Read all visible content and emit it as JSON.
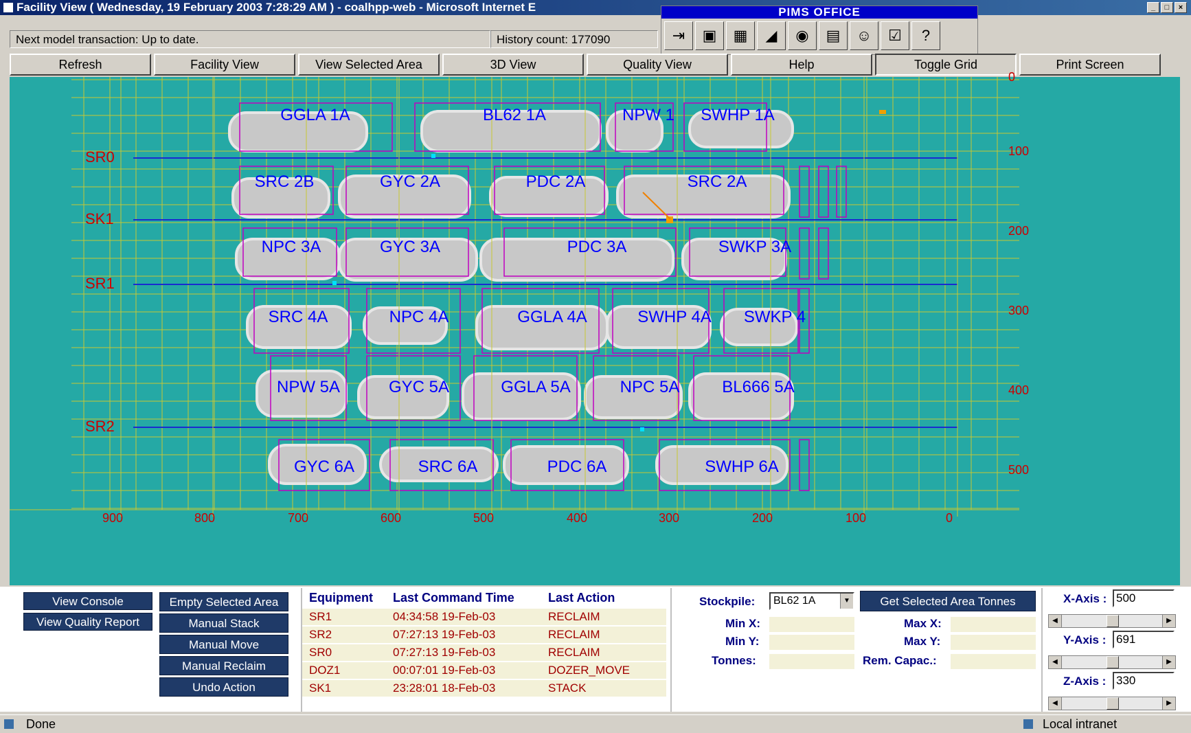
{
  "window": {
    "title": "Facility View ( Wednesday, 19 February 2003 7:28:29 AM ) - coalhpp-web - Microsoft Internet E"
  },
  "pims": {
    "title": "PIMS   OFFICE",
    "icons": [
      "exit-icon",
      "monitor-icon",
      "grid-icon",
      "signal-icon",
      "globe-icon",
      "report-icon",
      "person-icon",
      "checklist-icon",
      "help-icon"
    ],
    "glyphs": [
      "⇥",
      "▣",
      "▦",
      "◢",
      "◉",
      "▤",
      "☺",
      "☑",
      "?"
    ]
  },
  "status": {
    "model": "Next model transaction: Up to date.",
    "history": "History count: 177090"
  },
  "toolbar": [
    "Refresh",
    "Facility View",
    "View Selected Area",
    "3D View",
    "Quality View",
    "Help",
    "Toggle Grid",
    "Print Screen"
  ],
  "rails": [
    "SR0",
    "SK1",
    "SR1",
    "SR2"
  ],
  "stockpiles": [
    "GGLA 1A",
    "BL62 1A",
    "NPW 1",
    "SWHP 1A",
    "SRC 2B",
    "GYC 2A",
    "PDC 2A",
    "SRC 2A",
    "NPC 3A",
    "GYC 3A",
    "PDC 3A",
    "SWKP 3A",
    "SRC 4A",
    "NPC 4A",
    "GGLA 4A",
    "SWHP 4A",
    "SWKP 4",
    "NPW 5A",
    "GYC 5A",
    "GGLA 5A",
    "NPC 5A",
    "BL666 5A",
    "GYC 6A",
    "SRC 6A",
    "PDC 6A",
    "SWHP 6A"
  ],
  "xaxis": [
    "900",
    "800",
    "700",
    "600",
    "500",
    "400",
    "300",
    "200",
    "100",
    "0"
  ],
  "yaxis": [
    "0",
    "100",
    "200",
    "300",
    "400",
    "500"
  ],
  "buttons": {
    "view_console": "View Console",
    "view_quality": "View Quality Report",
    "empty_area": "Empty Selected Area",
    "manual_stack": "Manual Stack",
    "manual_move": "Manual Move",
    "manual_reclaim": "Manual Reclaim",
    "undo": "Undo Action"
  },
  "equipment": {
    "headers": [
      "Equipment",
      "Last Command Time",
      "Last Action"
    ],
    "rows": [
      [
        "SR1",
        "04:34:58 19-Feb-03",
        "RECLAIM"
      ],
      [
        "SR2",
        "07:27:13 19-Feb-03",
        "RECLAIM"
      ],
      [
        "SR0",
        "07:27:13 19-Feb-03",
        "RECLAIM"
      ],
      [
        "DOZ1",
        "00:07:01 19-Feb-03",
        "DOZER_MOVE"
      ],
      [
        "SK1",
        "23:28:01 18-Feb-03",
        "STACK"
      ]
    ]
  },
  "stockpile_panel": {
    "label": "Stockpile:",
    "selected": "BL62 1A",
    "get_button": "Get Selected Area Tonnes",
    "min_x": "Min X:",
    "max_x": "Max X:",
    "min_y": "Min Y:",
    "max_y": "Max Y:",
    "tonnes": "Tonnes:",
    "rem_capac": "Rem. Capac.:"
  },
  "axes": {
    "x_label": "X-Axis :",
    "x_value": "500",
    "y_label": "Y-Axis :",
    "y_value": "691",
    "z_label": "Z-Axis :",
    "z_value": "330"
  },
  "statusbar": {
    "left": "Done",
    "right": "Local intranet"
  }
}
